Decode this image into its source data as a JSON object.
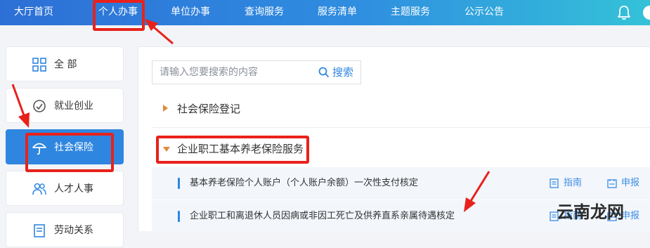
{
  "header": {
    "nav": [
      {
        "label": "大厅首页"
      },
      {
        "label": "个人办事"
      },
      {
        "label": "单位办事"
      },
      {
        "label": "查询服务"
      },
      {
        "label": "服务清单"
      },
      {
        "label": "主题服务"
      },
      {
        "label": "公示公告"
      }
    ],
    "active_nav": "个人办事",
    "icons": [
      "bell-icon",
      "avatar-icon"
    ]
  },
  "sidebar": {
    "items": [
      {
        "label": "全 部",
        "icon": "grid-icon"
      },
      {
        "label": "就业创业",
        "icon": "medal-icon"
      },
      {
        "label": "社会保险",
        "icon": "umbrella-icon",
        "active": true
      },
      {
        "label": "人才人事",
        "icon": "people-icon"
      },
      {
        "label": "劳动关系",
        "icon": "document-icon"
      }
    ]
  },
  "search": {
    "placeholder": "请输入您要搜索的内容",
    "button_label": "搜索"
  },
  "categories": [
    {
      "label": "社会保险登记",
      "expanded": false
    },
    {
      "label": "企业职工基本养老保险服务",
      "expanded": true
    }
  ],
  "services": [
    {
      "title": "基本养老保险个人账户（个人账户余额）一次性支付核定",
      "guide_label": "指南",
      "apply_label": "申报"
    },
    {
      "title": "企业职工和离退休人员因病或非因工死亡及供养直系亲属待遇核定",
      "guide_label": "指南",
      "apply_label": "申报"
    }
  ],
  "watermark": {
    "text": "云南龙网"
  },
  "colors": {
    "accent": "#2f86e0",
    "highlight": "#e8211b",
    "category_arrow": "#e08a3c"
  }
}
